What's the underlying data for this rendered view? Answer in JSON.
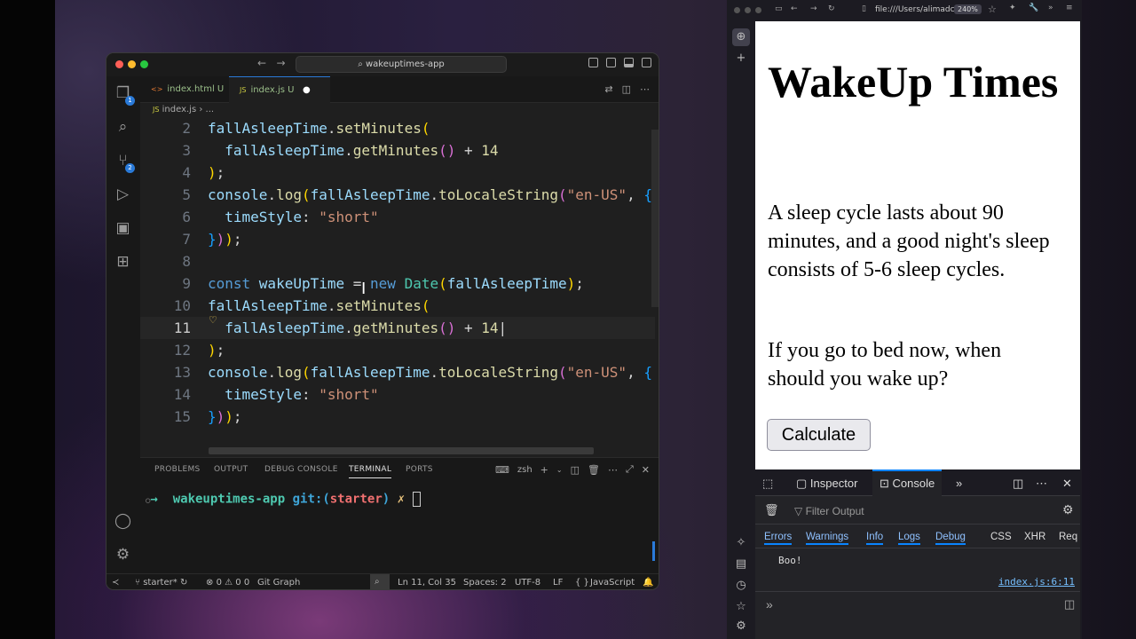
{
  "vscode": {
    "search": "wakeuptimes-app",
    "tabs": [
      {
        "icon": "<>",
        "label": "index.html",
        "status": "U"
      },
      {
        "icon": "JS",
        "label": "index.js",
        "status": "U",
        "modified": "●"
      }
    ],
    "breadcrumb": {
      "icon": "JS",
      "file": "index.js",
      "sep": "›",
      "rest": "..."
    },
    "activity_badges": {
      "explorer": "1",
      "scm": "2"
    },
    "current_line": "11",
    "code": [
      {
        "n": "2",
        "t": [
          [
            "v",
            "fallAsleepTime"
          ],
          [
            "p",
            "."
          ],
          [
            "f",
            "setMinutes"
          ],
          [
            "b1",
            "("
          ]
        ]
      },
      {
        "n": "3",
        "t": [
          [
            "p",
            "  "
          ],
          [
            "v",
            "fallAsleepTime"
          ],
          [
            "p",
            "."
          ],
          [
            "f",
            "getMinutes"
          ],
          [
            "b2",
            "()"
          ],
          [
            "p",
            " + "
          ],
          [
            "f",
            "14"
          ]
        ]
      },
      {
        "n": "4",
        "t": [
          [
            "b1",
            ")"
          ],
          [
            "p",
            ";"
          ]
        ]
      },
      {
        "n": "5",
        "t": [
          [
            "v",
            "console"
          ],
          [
            "p",
            "."
          ],
          [
            "f",
            "log"
          ],
          [
            "b1",
            "("
          ],
          [
            "v",
            "fallAsleepTime"
          ],
          [
            "p",
            "."
          ],
          [
            "f",
            "toLocaleString"
          ],
          [
            "b2",
            "("
          ],
          [
            "s",
            "\"en-US\""
          ],
          [
            "p",
            ", "
          ],
          [
            "b3",
            "{"
          ]
        ]
      },
      {
        "n": "6",
        "t": [
          [
            "p",
            "  "
          ],
          [
            "v",
            "timeStyle"
          ],
          [
            "p",
            ": "
          ],
          [
            "s",
            "\"short\""
          ]
        ]
      },
      {
        "n": "7",
        "t": [
          [
            "b3",
            "}"
          ],
          [
            "b2",
            ")"
          ],
          [
            "b1",
            ")"
          ],
          [
            "p",
            ";"
          ]
        ]
      },
      {
        "n": "8",
        "t": []
      },
      {
        "n": "9",
        "t": [
          [
            "k",
            "const "
          ],
          [
            "v",
            "wakeUpTime"
          ],
          [
            "p",
            " = "
          ],
          [
            "k",
            "new "
          ],
          [
            "c",
            "Date"
          ],
          [
            "b1",
            "("
          ],
          [
            "v",
            "fallAsleepTime"
          ],
          [
            "b1",
            ")"
          ],
          [
            "p",
            ";"
          ]
        ]
      },
      {
        "n": "10",
        "t": [
          [
            "v",
            "fallAsleepTime"
          ],
          [
            "p",
            "."
          ],
          [
            "f",
            "setMinutes"
          ],
          [
            "b1",
            "("
          ]
        ]
      },
      {
        "n": "11",
        "t": [
          [
            "p",
            "  "
          ],
          [
            "v",
            "fallAsleepTime"
          ],
          [
            "p",
            "."
          ],
          [
            "f",
            "getMinutes"
          ],
          [
            "b2",
            "()"
          ],
          [
            "p",
            " + "
          ],
          [
            "f",
            "14"
          ],
          [
            "p",
            "|"
          ]
        ]
      },
      {
        "n": "12",
        "t": [
          [
            "b1",
            ")"
          ],
          [
            "p",
            ";"
          ]
        ]
      },
      {
        "n": "13",
        "t": [
          [
            "v",
            "console"
          ],
          [
            "p",
            "."
          ],
          [
            "f",
            "log"
          ],
          [
            "b1",
            "("
          ],
          [
            "v",
            "fallAsleepTime"
          ],
          [
            "p",
            "."
          ],
          [
            "f",
            "toLocaleString"
          ],
          [
            "b2",
            "("
          ],
          [
            "s",
            "\"en-US\""
          ],
          [
            "p",
            ", "
          ],
          [
            "b3",
            "{"
          ]
        ]
      },
      {
        "n": "14",
        "t": [
          [
            "p",
            "  "
          ],
          [
            "v",
            "timeStyle"
          ],
          [
            "p",
            ": "
          ],
          [
            "s",
            "\"short\""
          ]
        ]
      },
      {
        "n": "15",
        "t": [
          [
            "b3",
            "}"
          ],
          [
            "b2",
            ")"
          ],
          [
            "b1",
            ")"
          ],
          [
            "p",
            ";"
          ]
        ]
      }
    ],
    "panel_tabs": [
      "PROBLEMS",
      "OUTPUT",
      "DEBUG CONSOLE",
      "TERMINAL",
      "PORTS"
    ],
    "active_panel_tab": "TERMINAL",
    "shell": "zsh",
    "terminal": {
      "arrow": "→",
      "dir": "wakeuptimes-app",
      "git": "git:",
      "paren_open": "(",
      "branch": "starter",
      "paren_close": ")",
      "dirty": "✗"
    },
    "status": {
      "branch": "starter*",
      "errors": "0",
      "warnings": "0",
      "problems_suffix": "0",
      "gitgraph": "Git Graph",
      "position": "Ln 11, Col 35",
      "spaces": "Spaces: 2",
      "encoding": "UTF-8",
      "eol": "LF",
      "braces": "{ }",
      "language": "JavaScript"
    }
  },
  "browser": {
    "url": "file:///Users/alimadc",
    "zoom": "240%",
    "page": {
      "title": "WakeUp Times",
      "p1": "A sleep cycle lasts about 90 minutes, and a good night's sleep consists of 5-6 sleep cycles.",
      "p2": "If you go to bed now, when should you wake up?",
      "button": "Calculate"
    },
    "devtools": {
      "tabs": {
        "inspector": "Inspector",
        "console": "Console"
      },
      "filter_placeholder": "Filter Output",
      "levels": [
        "Errors",
        "Warnings",
        "Info",
        "Logs",
        "Debug"
      ],
      "other_filters": [
        "CSS",
        "XHR",
        "Req"
      ],
      "message": "Boo!",
      "message_source": "index.js:6:11",
      "prompt": "»"
    }
  },
  "colors": {
    "vscode_bg": "#1f1f1f",
    "accent": "#2a7ad8",
    "term_green": "#4ec9b0",
    "term_blue": "#3ea5d8",
    "term_red": "#f07070",
    "link": "#75bfff"
  }
}
